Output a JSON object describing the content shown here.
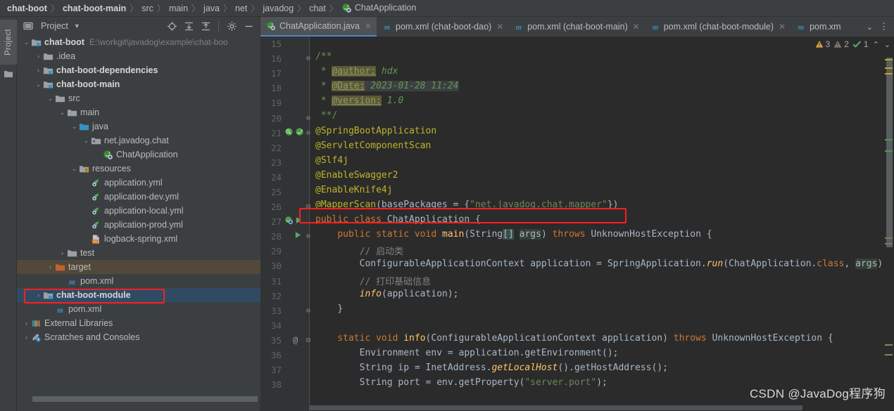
{
  "breadcrumb": {
    "items": [
      {
        "label": "chat-boot",
        "bold": true,
        "icon": "none"
      },
      {
        "label": "chat-boot-main",
        "bold": true,
        "icon": "none"
      },
      {
        "label": "src",
        "bold": false,
        "icon": "none"
      },
      {
        "label": "main",
        "bold": false,
        "icon": "none"
      },
      {
        "label": "java",
        "bold": false,
        "icon": "none"
      },
      {
        "label": "net",
        "bold": false,
        "icon": "none"
      },
      {
        "label": "javadog",
        "bold": false,
        "icon": "none"
      },
      {
        "label": "chat",
        "bold": false,
        "icon": "none"
      },
      {
        "label": "ChatApplication",
        "bold": false,
        "icon": "spring-class-icon"
      }
    ],
    "separator": "〉"
  },
  "toolstrip": {
    "label": "Project",
    "icon": "folder-icon"
  },
  "project_panel": {
    "title": "Project",
    "caret": "▼",
    "tools": [
      {
        "name": "locate-icon",
        "title": "Select Opened File"
      },
      {
        "name": "expand-all-icon",
        "title": "Expand All"
      },
      {
        "name": "collapse-all-icon",
        "title": "Collapse All"
      },
      {
        "name": "gear-icon",
        "title": "Settings"
      },
      {
        "name": "minimize-icon",
        "title": "Hide"
      }
    ],
    "tree": [
      {
        "indent": 0,
        "arrow": "⌄",
        "icon": "module-icon",
        "label": "chat-boot",
        "bold": true,
        "path": "E:\\workgit\\javadog\\example\\chat-boo",
        "state": "normal"
      },
      {
        "indent": 1,
        "arrow": "›",
        "icon": "folder-icon",
        "label": ".idea",
        "bold": false,
        "path": "",
        "state": "normal"
      },
      {
        "indent": 1,
        "arrow": "›",
        "icon": "module-icon",
        "label": "chat-boot-dependencies",
        "bold": true,
        "path": "",
        "state": "normal"
      },
      {
        "indent": 1,
        "arrow": "⌄",
        "icon": "module-icon",
        "label": "chat-boot-main",
        "bold": true,
        "path": "",
        "state": "normal"
      },
      {
        "indent": 2,
        "arrow": "⌄",
        "icon": "folder-icon",
        "label": "src",
        "bold": false,
        "path": "",
        "state": "normal"
      },
      {
        "indent": 3,
        "arrow": "⌄",
        "icon": "folder-icon",
        "label": "main",
        "bold": false,
        "path": "",
        "state": "normal"
      },
      {
        "indent": 4,
        "arrow": "⌄",
        "icon": "source-folder-icon",
        "label": "java",
        "bold": false,
        "path": "",
        "state": "normal"
      },
      {
        "indent": 5,
        "arrow": "⌄",
        "icon": "package-icon",
        "label": "net.javadog.chat",
        "bold": false,
        "path": "",
        "state": "normal"
      },
      {
        "indent": 6,
        "arrow": "",
        "icon": "spring-class-icon",
        "label": "ChatApplication",
        "bold": false,
        "path": "",
        "state": "normal"
      },
      {
        "indent": 4,
        "arrow": "⌄",
        "icon": "resources-folder-icon",
        "label": "resources",
        "bold": false,
        "path": "",
        "state": "normal"
      },
      {
        "indent": 5,
        "arrow": "",
        "icon": "yml-icon",
        "label": "application.yml",
        "bold": false,
        "path": "",
        "state": "normal"
      },
      {
        "indent": 5,
        "arrow": "",
        "icon": "yml-icon",
        "label": "application-dev.yml",
        "bold": false,
        "path": "",
        "state": "normal"
      },
      {
        "indent": 5,
        "arrow": "",
        "icon": "yml-icon",
        "label": "application-local.yml",
        "bold": false,
        "path": "",
        "state": "normal"
      },
      {
        "indent": 5,
        "arrow": "",
        "icon": "yml-icon",
        "label": "application-prod.yml",
        "bold": false,
        "path": "",
        "state": "normal"
      },
      {
        "indent": 5,
        "arrow": "",
        "icon": "xml-icon",
        "label": "logback-spring.xml",
        "bold": false,
        "path": "",
        "state": "normal"
      },
      {
        "indent": 3,
        "arrow": "›",
        "icon": "folder-icon",
        "label": "test",
        "bold": false,
        "path": "",
        "state": "normal"
      },
      {
        "indent": 2,
        "arrow": "›",
        "icon": "target-folder-icon",
        "label": "target",
        "bold": false,
        "path": "",
        "state": "hl-target"
      },
      {
        "indent": 3,
        "arrow": "",
        "icon": "maven-icon",
        "label": "pom.xml",
        "bold": false,
        "path": "",
        "state": "normal"
      },
      {
        "indent": 1,
        "arrow": "›",
        "icon": "module-icon",
        "label": "chat-boot-module",
        "bold": true,
        "path": "",
        "state": "selected"
      },
      {
        "indent": 2,
        "arrow": "",
        "icon": "maven-icon",
        "label": "pom.xml",
        "bold": false,
        "path": "",
        "state": "normal"
      },
      {
        "indent": 0,
        "arrow": "›",
        "icon": "libraries-icon",
        "label": "External Libraries",
        "bold": false,
        "path": "",
        "state": "normal"
      },
      {
        "indent": 0,
        "arrow": "›",
        "icon": "scratches-icon",
        "label": "Scratches and Consoles",
        "bold": false,
        "path": "",
        "state": "normal"
      }
    ],
    "annotation_box": {
      "label": "pom-xml-highlight-box",
      "color": "#ff1e1e"
    }
  },
  "editor": {
    "tabs": [
      {
        "label": "ChatApplication.java",
        "icon": "spring-class-icon",
        "active": true,
        "close": "✕"
      },
      {
        "label": "pom.xml (chat-boot-dao)",
        "icon": "maven-icon",
        "active": false,
        "close": "✕"
      },
      {
        "label": "pom.xml (chat-boot-main)",
        "icon": "maven-icon",
        "active": false,
        "close": "✕"
      },
      {
        "label": "pom.xml (chat-boot-module)",
        "icon": "maven-icon",
        "active": false,
        "close": "✕"
      },
      {
        "label": "pom.xm",
        "icon": "maven-icon",
        "active": false,
        "close": ""
      }
    ],
    "tabbar_actions": [
      {
        "name": "chevron-down-icon",
        "glyph": "⌄"
      },
      {
        "name": "kebab-menu-icon",
        "glyph": "⋮"
      }
    ],
    "inspections": {
      "warnings": "3",
      "weak_warnings": "2",
      "ok": "1",
      "prev_glyph": "⌃",
      "next_glyph": "⌄"
    },
    "annotation_box": {
      "label": "mapperscan-highlight-box",
      "color": "#ff1e1e"
    },
    "lines": [
      {
        "num": "15"
      },
      {
        "num": "16"
      },
      {
        "num": "17"
      },
      {
        "num": "18"
      },
      {
        "num": "19"
      },
      {
        "num": "20"
      },
      {
        "num": "21"
      },
      {
        "num": "22"
      },
      {
        "num": "23"
      },
      {
        "num": "24"
      },
      {
        "num": "25"
      },
      {
        "num": "26"
      },
      {
        "num": "27"
      },
      {
        "num": "28"
      },
      {
        "num": "29"
      },
      {
        "num": "30"
      },
      {
        "num": "31"
      },
      {
        "num": "32"
      },
      {
        "num": "33"
      },
      {
        "num": "34"
      },
      {
        "num": "35"
      },
      {
        "num": "36"
      },
      {
        "num": "37"
      },
      {
        "num": "38"
      }
    ],
    "code_text": [
      "",
      "/**",
      " * @author: hdx",
      " * @Date: 2023-01-28 11:24",
      " * @version: 1.0",
      " **/",
      "@SpringBootApplication",
      "@ServletComponentScan",
      "@Slf4j",
      "@EnableSwagger2",
      "@EnableKnife4j",
      "@MapperScan(basePackages = {\"net.javadog.chat.mapper\"})",
      "public class ChatApplication {",
      "    public static void main(String[] args) throws UnknownHostException {",
      "        // 启动类",
      "        ConfigurableApplicationContext application = SpringApplication.run(ChatApplication.class, args);",
      "        // 打印基础信息",
      "        info(application);",
      "    }",
      "",
      "    static void info(ConfigurableApplicationContext application) throws UnknownHostException {",
      "        Environment env = application.getEnvironment();",
      "        String ip = InetAddress.getLocalHost().getHostAddress();",
      "        String port = env.getProperty(\"server.port\");"
    ]
  },
  "watermark": "CSDN @JavaDog程序狗"
}
